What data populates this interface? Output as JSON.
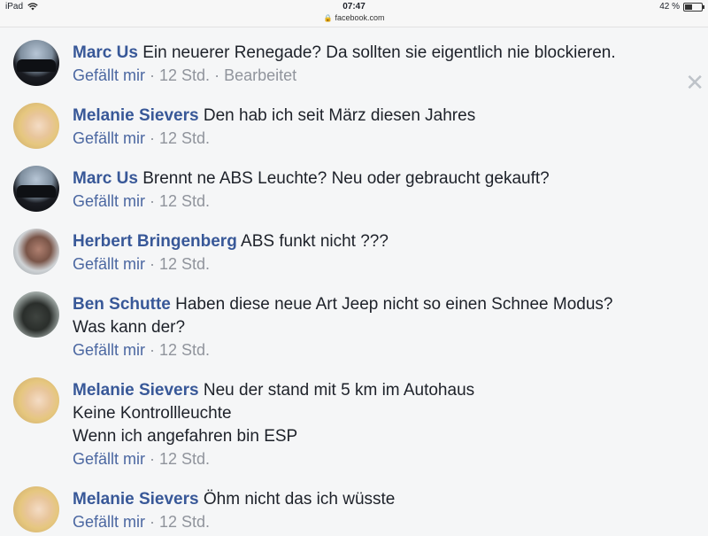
{
  "status_bar": {
    "device": "iPad",
    "time": "07:47",
    "url": "facebook.com",
    "battery": "42 %",
    "battery_level": 0.42
  },
  "comments": [
    {
      "author": "Marc Us",
      "lines": [
        "Ein neuerer Renegade? Da sollten sie eigentlich nie blockieren."
      ],
      "like": "Gefällt mir",
      "time": "12 Std.",
      "edited": "Bearbeitet"
    },
    {
      "author": "Melanie Sievers",
      "lines": [
        "Den hab ich seit März diesen Jahres"
      ],
      "like": "Gefällt mir",
      "time": "12 Std."
    },
    {
      "author": "Marc Us",
      "lines": [
        "Brennt ne ABS Leuchte? Neu oder gebraucht gekauft?"
      ],
      "like": "Gefällt mir",
      "time": "12 Std."
    },
    {
      "author": "Herbert Bringenberg",
      "lines": [
        "ABS funkt nicht ???"
      ],
      "like": "Gefällt mir",
      "time": "12 Std."
    },
    {
      "author": "Ben Schutte",
      "lines": [
        "Haben diese neue Art Jeep nicht so einen Schnee Modus?",
        "Was kann der?"
      ],
      "like": "Gefällt mir",
      "time": "12 Std."
    },
    {
      "author": "Melanie Sievers",
      "lines": [
        "Neu der stand mit 5 km im Autohaus",
        "Keine Kontrollleuchte",
        "Wenn ich angefahren bin ESP"
      ],
      "like": "Gefällt mir",
      "time": "12 Std."
    },
    {
      "author": "Melanie Sievers",
      "lines": [
        "Öhm nicht das ich wüsste"
      ],
      "like": "Gefällt mir",
      "time": "12 Std."
    }
  ],
  "icons": {
    "close": "close-icon",
    "wifi": "wifi-icon",
    "lock": "lock-icon",
    "battery": "battery-icon"
  }
}
